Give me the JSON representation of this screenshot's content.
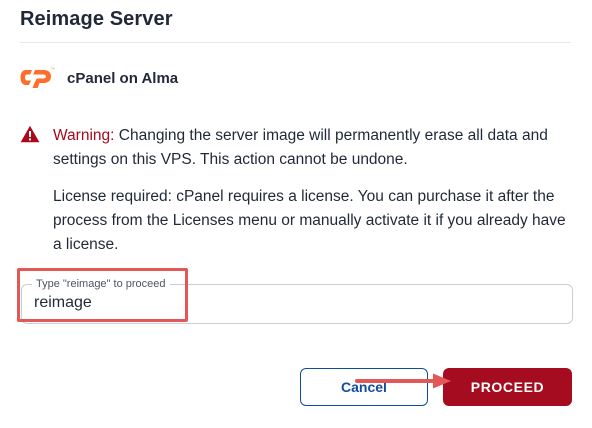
{
  "dialog": {
    "title": "Reimage Server",
    "os_name": "cPanel on Alma",
    "os_logo_icon": "cpanel-logo",
    "warning": {
      "icon": "warning-triangle-icon",
      "label": "Warning:",
      "text": " Changing the server image will permanently erase all data and settings on this VPS. This action cannot be undone."
    },
    "license_text": "License required: cPanel requires a license. You can purchase it after the process from the Licenses menu or manually activate it if you already have a license.",
    "confirm_field": {
      "label": "Type \"reimage\" to proceed",
      "value": "reimage"
    },
    "buttons": {
      "cancel": "Cancel",
      "proceed": "PROCEED"
    }
  },
  "colors": {
    "accent_red": "#a50c1f",
    "link_blue": "#0f4e9e",
    "cpanel_orange": "#ff6c2c",
    "annotation_red": "#e45757"
  }
}
